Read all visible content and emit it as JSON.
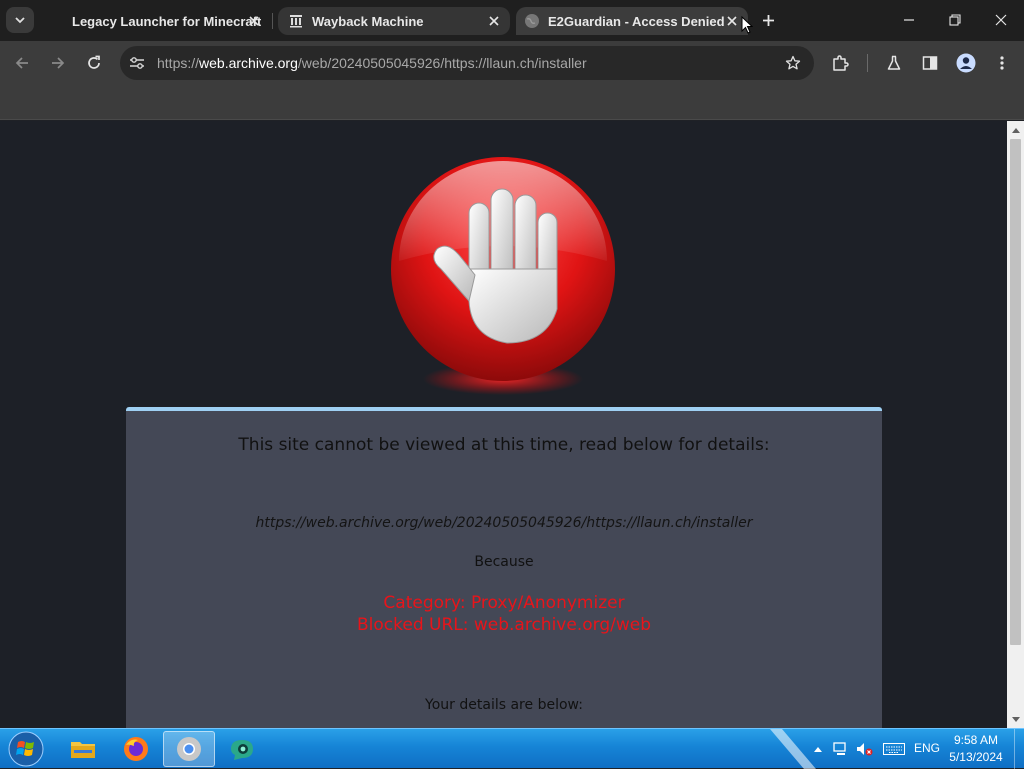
{
  "tabs": [
    {
      "title": "Legacy Launcher for Minecraft",
      "favicon": "none"
    },
    {
      "title": "Wayback Machine",
      "favicon": "archive-columns-icon"
    },
    {
      "title": "E2Guardian - Access Denied",
      "favicon": "globe-icon",
      "active": true
    }
  ],
  "address_bar": {
    "scheme": "https://",
    "host": "web.archive.org",
    "path": "/web/20240505045926/https://llaun.ch/installer"
  },
  "block_page": {
    "heading": "This site cannot be viewed at this time, read below for details:",
    "url": "https://web.archive.org/web/20240505045926/https://llaun.ch/installer",
    "because": "Because",
    "category": "Category: Proxy/Anonymizer",
    "blocked_url": "Blocked URL: web.archive.org/web",
    "details": "Your details are below:"
  },
  "taskbar": {
    "language": "ENG",
    "time": "9:58 AM",
    "date": "5/13/2024"
  },
  "colors": {
    "tab_strip": "#1f1f1f",
    "toolbar": "#3c3c3c",
    "page_bg": "#1d2027",
    "panel_bg": "#444856",
    "panel_border": "#9fd0f3",
    "block_red": "#e8141a",
    "taskbar": "#1684d6"
  }
}
